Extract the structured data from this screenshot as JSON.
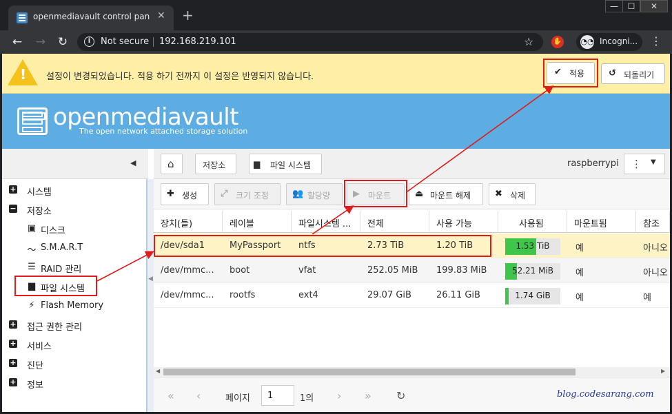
{
  "browser": {
    "tab_title": "openmediavault control panel - r",
    "close": "✕",
    "new_tab": "+",
    "not_secure": "Not secure",
    "url": "192.168.219.101",
    "profile": "Incogni...",
    "window_min": "—",
    "window_max": "☐",
    "window_close": "✕"
  },
  "banner": {
    "message": "설정이 변경되었습니다. 적용 하기 전까지 이 설정은 반영되지 않습니다.",
    "apply_label": "적용",
    "revert_label": "되돌리기"
  },
  "header": {
    "logo_title": "openmediavault",
    "logo_subtitle": "The open network attached storage solution"
  },
  "sidebar": {
    "items": [
      {
        "toggle": "+",
        "label": "시스템"
      },
      {
        "toggle": "−",
        "label": "저장소"
      },
      {
        "icon": "disk-icon",
        "label": "디스크"
      },
      {
        "icon": "pulse-icon",
        "label": "S.M.A.R.T"
      },
      {
        "icon": "database-icon",
        "label": "RAID 관리"
      },
      {
        "icon": "folder-icon",
        "label": "파일 시스템"
      },
      {
        "icon": "bolt-icon",
        "label": "Flash Memory"
      },
      {
        "toggle": "+",
        "label": "접근 권한 관리"
      },
      {
        "toggle": "+",
        "label": "서비스"
      },
      {
        "toggle": "+",
        "label": "진단"
      },
      {
        "toggle": "+",
        "label": "정보"
      }
    ]
  },
  "breadcrumb": {
    "storage": "저장소",
    "filesystems": "파일 시스템",
    "host": "raspberrypi"
  },
  "actions": {
    "create": "생성",
    "resize": "크기 조정",
    "quota": "할당량",
    "mount": "마운트",
    "unmount": "마운트 해제",
    "delete": "삭제"
  },
  "grid": {
    "columns": [
      "장치(들)",
      "레이블",
      "파일시스템 ...",
      "전체",
      "사용 가능",
      "사용됨",
      "마운트됨",
      "참조"
    ],
    "rows": [
      {
        "device": "/dev/sda1",
        "label": "MyPassport",
        "fs": "ntfs",
        "total": "2.73 TiB",
        "available": "1.20 TiB",
        "used": "1.53 TiB",
        "used_pct": 56,
        "mounted": "예",
        "ref": "아니오"
      },
      {
        "device": "/dev/mmc...",
        "label": "boot",
        "fs": "vfat",
        "total": "252.05 MiB",
        "available": "199.83 MiB",
        "used": "52.21 MiB",
        "used_pct": 21,
        "mounted": "예",
        "ref": "아니오"
      },
      {
        "device": "/dev/mmc...",
        "label": "rootfs",
        "fs": "ext4",
        "total": "29.07 GiB",
        "available": "26.11 GiB",
        "used": "1.74 GiB",
        "used_pct": 6,
        "mounted": "예",
        "ref": "예"
      }
    ]
  },
  "pager": {
    "page_label": "페이지",
    "page_value": "1",
    "of_label": "1의"
  },
  "watermark": "blog.codesarang.com",
  "colors": {
    "highlight": "#e01b1b",
    "header": "#5dade2",
    "banner": "#fdf0a6",
    "used_bar": "#3fc54a"
  }
}
